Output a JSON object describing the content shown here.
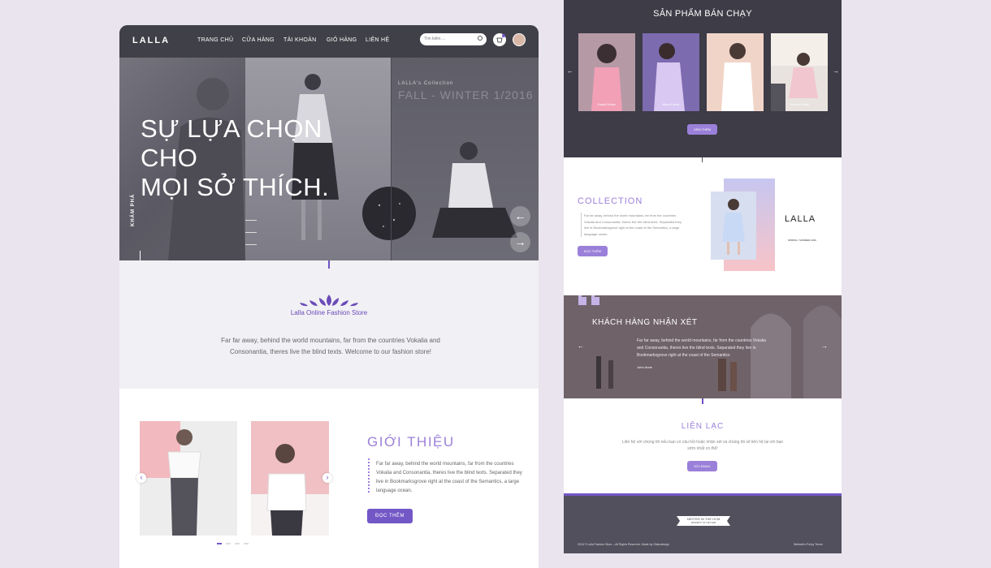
{
  "left_page": {
    "nav": {
      "logo": "LALLA",
      "items": [
        "TRANG CHỦ",
        "CỬA HÀNG",
        "TÀI KHOẢN",
        "GIỎ HÀNG",
        "LIÊN HỆ"
      ],
      "search_placeholder": "Tìm kiếm ..."
    },
    "hero": {
      "title": "SỰ LỰA CHỌN CHO\nMỌI SỞ THÍCH.",
      "collection_sub": "LALLA's Collection",
      "collection_title": "FALL - WINTER 1/2016",
      "side_label": "KHÁM PHÁ",
      "prev_arrow": "←",
      "next_arrow": "→"
    },
    "intro": {
      "brand": "Lalla Online Fashion Store",
      "text": "Far far away, behind the world mountains, far from the countries Vokalia and Consonantia, theres live the blind texts. Welcome to our fashion store!"
    },
    "about": {
      "title": "GIỚI THIỆU",
      "text": "Far far away, behind the world mountains, far from the countries Vokalia and Consonantia, theres live the blind texts. Separated they live in Bookmarksgrove right at the coast of the Semantics, a large language ocean.",
      "button": "ĐỌC THÊM",
      "prev": "‹",
      "next": "›"
    }
  },
  "right_page": {
    "bestsellers": {
      "title": "SẢN PHẨM BÁN CHẠY",
      "products": [
        "Kanni Dress",
        "Mirra Dress",
        "Kenit Dress",
        "Karma Dress"
      ],
      "button": "XEM THÊM",
      "prev": "←",
      "next": "→"
    },
    "collection": {
      "title": "COLLECTION",
      "text": "Far far away, behind the world mountains, far from the countries Vokalia and Consonantia, theres live the blind texts. Separated they live in Bookmarksgrove right at the coast of the Semantics, a large language ocean.",
      "button": "ĐỌC THÊM",
      "brand": "LALLA",
      "brand_sub": "SPRING / SUMMER 2016"
    },
    "reviews": {
      "title": "KHÁCH HÀNG NHẬN XÉT",
      "text": "Far far away, behind the world mountains, far from the countries Vokalia and Consonantia, theres live the blind texts. Separated they live in Bookmarksgrove right at the coast of the Semantics",
      "author": "John Anne",
      "prev": "←",
      "next": "→"
    },
    "contact": {
      "title": "LIÊN LẠC",
      "text": "Liên hệ với chúng tôi nếu bạn có câu hỏi hoặc nhận xét và chúng tôi sẽ liên hệ lại với bạn sớm nhất có thể!",
      "button": "GỬI EMAIL"
    },
    "footer": {
      "badge_line1": "NESTED IN THE HCM",
      "badge_line2": "PROPERTY OF VIET NAM",
      "copyright": "2016 © Lalla Fashion Store – All Rights Reserved. Made by Otakudesign",
      "links": "Website's Policy Terms"
    }
  },
  "colors": {
    "accent": "#7357c6",
    "accent_light": "#9b80d9",
    "dark": "#3d3c47",
    "background": "#e9e4ee"
  }
}
